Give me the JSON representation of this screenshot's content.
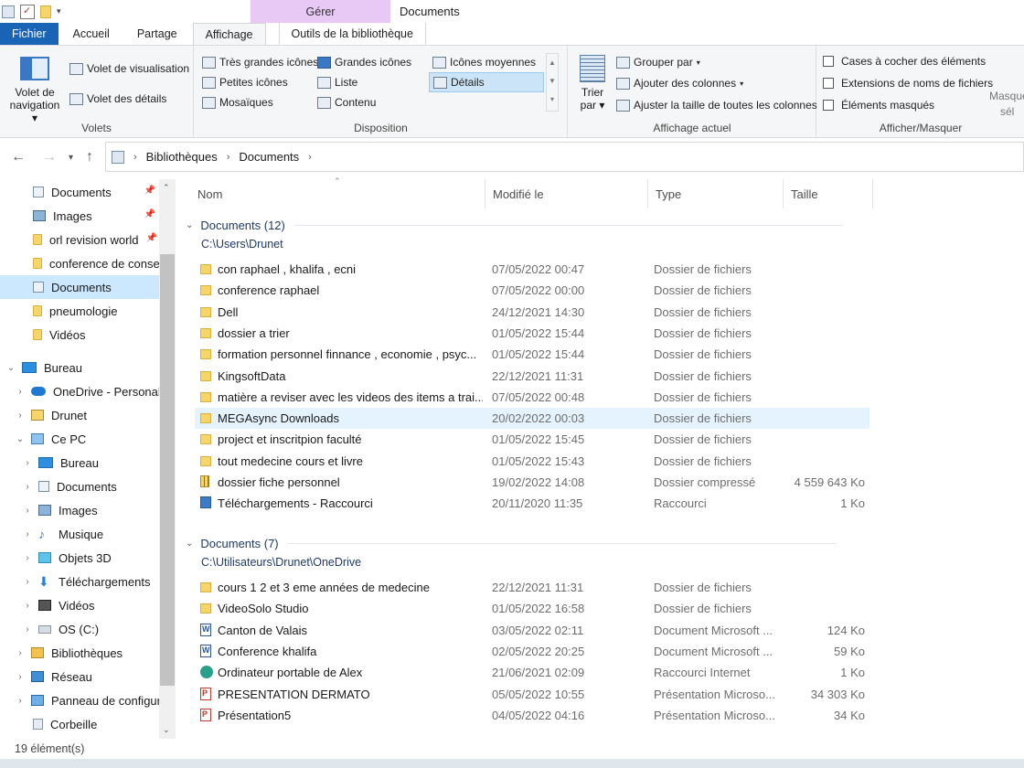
{
  "titlebar": {
    "context_tab": "Gérer",
    "window_title": "Documents"
  },
  "tabs": [
    {
      "label": "Fichier"
    },
    {
      "label": "Accueil"
    },
    {
      "label": "Partage"
    },
    {
      "label": "Affichage"
    },
    {
      "label": "Outils de la bibliothèque"
    }
  ],
  "ribbon": {
    "volets": {
      "nav_label": "Volet de",
      "nav_label2": "navigation",
      "preview": "Volet de visualisation",
      "details": "Volet des détails",
      "group": "Volets"
    },
    "disposition": {
      "items": [
        "Très grandes icônes",
        "Grandes icônes",
        "Icônes moyennes",
        "Petites icônes",
        "Liste",
        "Détails",
        "Mosaïques",
        "Contenu"
      ],
      "group": "Disposition"
    },
    "affichage": {
      "sort_label": "Trier",
      "sort_label2": "par",
      "group_by": "Grouper par",
      "add_columns": "Ajouter des colonnes",
      "fit_columns": "Ajuster la taille de toutes les colonnes",
      "group": "Affichage actuel"
    },
    "afficher": {
      "checkboxes": [
        "Cases à cocher des éléments",
        "Extensions de noms de fichiers",
        "Éléments masqués"
      ],
      "hide_selected": "Masquer",
      "hide_selected2": "sél",
      "group": "Afficher/Masquer"
    }
  },
  "breadcrumb": [
    "Bibliothèques",
    "Documents"
  ],
  "navpane": {
    "quick": [
      "Documents",
      "Images",
      "orl revision world",
      "conference de conse",
      "Documents",
      "pneumologie",
      "Vidéos"
    ],
    "tree": [
      "Bureau",
      "OneDrive - Personal",
      "Drunet",
      "Ce PC",
      "Bureau",
      "Documents",
      "Images",
      "Musique",
      "Objets 3D",
      "Téléchargements",
      "Vidéos",
      "OS (C:)",
      "Bibliothèques",
      "Réseau",
      "Panneau de configur",
      "Corbeille"
    ]
  },
  "columns": [
    "Nom",
    "Modifié le",
    "Type",
    "Taille"
  ],
  "groups": [
    {
      "title": "Documents (12)",
      "path": "C:\\Users\\Drunet",
      "rows": [
        {
          "name": "con raphael , khalifa , ecni",
          "date": "07/05/2022 00:47",
          "type": "Dossier de fichiers",
          "size": "",
          "icon": "folder-icon"
        },
        {
          "name": "conference raphael",
          "date": "07/05/2022 00:00",
          "type": "Dossier de fichiers",
          "size": "",
          "icon": "folder-icon"
        },
        {
          "name": "Dell",
          "date": "24/12/2021 14:30",
          "type": "Dossier de fichiers",
          "size": "",
          "icon": "folder-icon"
        },
        {
          "name": "dossier a trier",
          "date": "01/05/2022 15:44",
          "type": "Dossier de fichiers",
          "size": "",
          "icon": "folder-icon"
        },
        {
          "name": "formation personnel finnance , economie , psyc...",
          "date": "01/05/2022 15:44",
          "type": "Dossier de fichiers",
          "size": "",
          "icon": "folder-icon"
        },
        {
          "name": "KingsoftData",
          "date": "22/12/2021 11:31",
          "type": "Dossier de fichiers",
          "size": "",
          "icon": "folder-icon"
        },
        {
          "name": "matière a reviser avec les videos des items a trai...",
          "date": "07/05/2022 00:48",
          "type": "Dossier de fichiers",
          "size": "",
          "icon": "folder-icon"
        },
        {
          "name": "MEGAsync Downloads",
          "date": "20/02/2022 00:03",
          "type": "Dossier de fichiers",
          "size": "",
          "icon": "folder-icon"
        },
        {
          "name": "project et inscritpion faculté",
          "date": "01/05/2022 15:45",
          "type": "Dossier de fichiers",
          "size": "",
          "icon": "folder-icon"
        },
        {
          "name": "tout medecine cours et livre",
          "date": "01/05/2022 15:43",
          "type": "Dossier de fichiers",
          "size": "",
          "icon": "folder-icon"
        },
        {
          "name": "dossier fiche personnel",
          "date": "19/02/2022 14:08",
          "type": "Dossier compressé",
          "size": "4 559 643 Ko",
          "icon": "zip-folder-icon"
        },
        {
          "name": "Téléchargements - Raccourci",
          "date": "20/11/2020 11:35",
          "type": "Raccourci",
          "size": "1 Ko",
          "icon": "shortcut-icon"
        }
      ]
    },
    {
      "title": "Documents (7)",
      "path": "C:\\Utilisateurs\\Drunet\\OneDrive",
      "rows": [
        {
          "name": "cours 1 2 et 3 eme années de medecine",
          "date": "22/12/2021 11:31",
          "type": "Dossier de fichiers",
          "size": "",
          "icon": "folder-icon"
        },
        {
          "name": "VideoSolo Studio",
          "date": "01/05/2022 16:58",
          "type": "Dossier de fichiers",
          "size": "",
          "icon": "folder-icon"
        },
        {
          "name": "Canton de Valais",
          "date": "03/05/2022 02:11",
          "type": "Document Microsoft ...",
          "size": "124 Ko",
          "icon": "word-icon"
        },
        {
          "name": "Conference khalifa",
          "date": "02/05/2022 20:25",
          "type": "Document Microsoft ...",
          "size": "59 Ko",
          "icon": "word-icon"
        },
        {
          "name": "Ordinateur portable de Alex",
          "date": "21/06/2021 02:09",
          "type": "Raccourci Internet",
          "size": "1 Ko",
          "icon": "edge-icon"
        },
        {
          "name": "PRESENTATION DERMATO",
          "date": "05/05/2022 10:55",
          "type": "Présentation Microso...",
          "size": "34 303 Ko",
          "icon": "powerpoint-icon"
        },
        {
          "name": "Présentation5",
          "date": "04/05/2022 04:16",
          "type": "Présentation Microso...",
          "size": "34 Ko",
          "icon": "powerpoint-icon"
        }
      ]
    }
  ],
  "status": "19 élément(s)",
  "colors": {
    "file_tab": "#1a64b8",
    "context": "#e8c8f5",
    "selected": "#cce8ff",
    "folder": "#f6d66b"
  }
}
